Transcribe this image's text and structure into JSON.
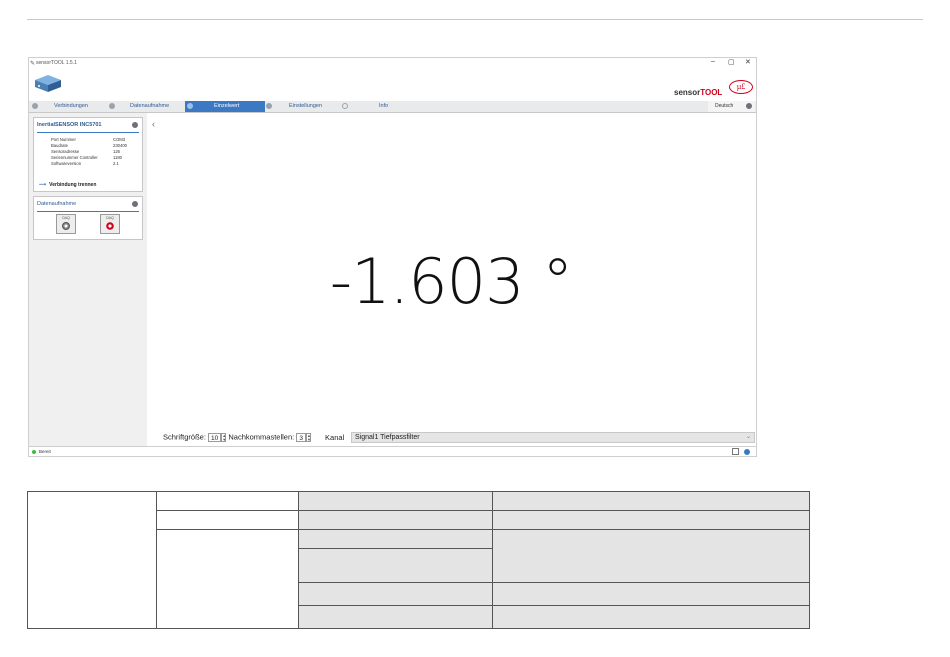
{
  "window": {
    "title": "sensorTOOL 1.5.1",
    "controls": {
      "minimize": "–",
      "maximize": "▢",
      "close": "✕"
    }
  },
  "brand": {
    "sensor": "sensor",
    "tool": "TOOL"
  },
  "nav": {
    "tabs": [
      {
        "label": "Verbindungen"
      },
      {
        "label": "Datenaufnahme"
      },
      {
        "label": "Einzelwert"
      },
      {
        "label": "Einstellungen"
      },
      {
        "label": "Info"
      }
    ],
    "active_tab": "Einzelwert",
    "language": "Deutsch"
  },
  "sensor_panel": {
    "title": "InertialSENSOR INC5701",
    "rows": [
      {
        "label": "Port Nummer",
        "value": "COM3"
      },
      {
        "label": "Baudrate",
        "value": "230400"
      },
      {
        "label": "Sensoradresse",
        "value": "126"
      },
      {
        "label": "Seriennummer Controller",
        "value": "1180"
      },
      {
        "label": "Softwareversion",
        "value": "2.1"
      }
    ],
    "disconnect_label": "Verbindung trennen"
  },
  "data_panel": {
    "title": "Datenaufnahme",
    "buttons": [
      {
        "label": "DAQ"
      },
      {
        "label": "DAQ"
      }
    ]
  },
  "display": {
    "value": "-1.603 °"
  },
  "controls": {
    "font_size_label": "Schriftgröße:",
    "font_size_value": "10",
    "decimals_label": "Nachkommastellen:",
    "decimals_value": "3",
    "channel_label": "Kanal",
    "channel_value": "Signal1 Tiefpassfilter"
  },
  "status": {
    "text": "Bereit"
  },
  "colors": {
    "accent": "#3b79c4",
    "brand_red": "#d0021b",
    "status_ok": "#3bbf3b"
  }
}
